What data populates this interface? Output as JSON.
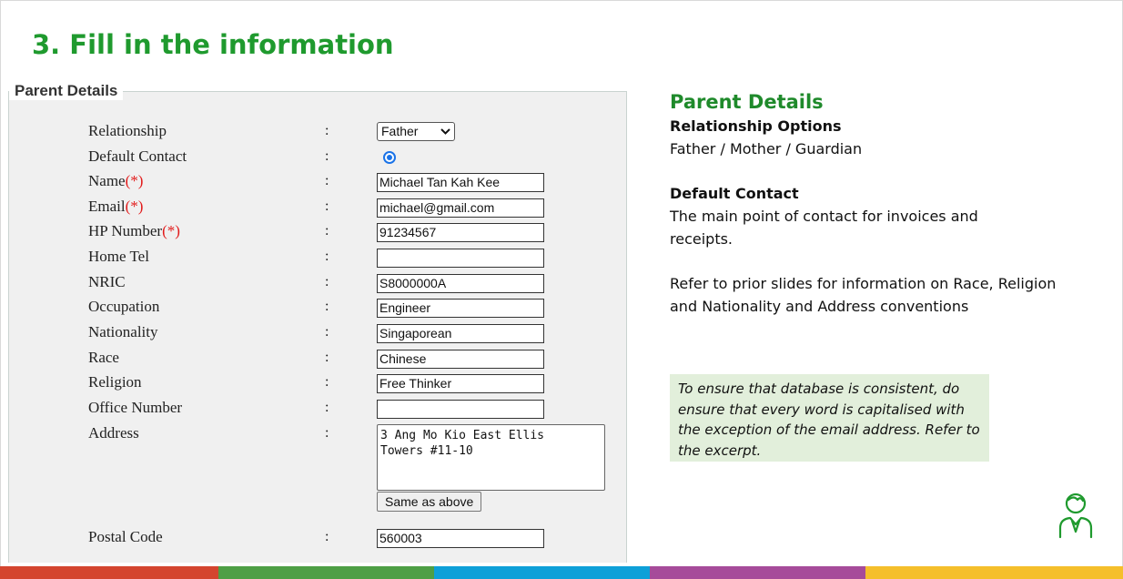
{
  "slide": {
    "title": "3. Fill in the information"
  },
  "form": {
    "legend": "Parent Details",
    "colon": ":",
    "required_marker": "(*)",
    "fields": {
      "relationship": {
        "label": "Relationship",
        "value": "Father"
      },
      "default_contact": {
        "label": "Default Contact",
        "checked": true
      },
      "name": {
        "label": "Name",
        "value": "Michael Tan Kah Kee"
      },
      "email": {
        "label": "Email",
        "value": "michael@gmail.com"
      },
      "hp": {
        "label": "HP Number",
        "value": "91234567"
      },
      "home_tel": {
        "label": "Home Tel",
        "value": ""
      },
      "nric": {
        "label": "NRIC",
        "value": "S8000000A"
      },
      "occupation": {
        "label": "Occupation",
        "value": "Engineer"
      },
      "nationality": {
        "label": "Nationality",
        "value": "Singaporean"
      },
      "race": {
        "label": "Race",
        "value": "Chinese"
      },
      "religion": {
        "label": "Religion",
        "value": "Free Thinker"
      },
      "office": {
        "label": "Office Number",
        "value": ""
      },
      "address": {
        "label": "Address",
        "value": "3 Ang Mo Kio East Ellis\nTowers #11-10"
      },
      "postal": {
        "label": "Postal Code",
        "value": "560003"
      }
    },
    "same_as_above_label": "Same as above"
  },
  "info": {
    "heading": "Parent Details",
    "relationship_title": "Relationship Options",
    "relationship_text": "Father / Mother / Guardian",
    "default_title": "Default Contact",
    "default_text": "The main point of contact for invoices and receipts.",
    "refer_text": "Refer to prior slides for information on Race, Religion and Nationality and Address conventions",
    "note": "To ensure that database is consistent, do ensure that every word is capitalised with the exception of the email address. Refer to the excerpt."
  },
  "colors": {
    "title_green": "#1f9a2e",
    "note_bg": "#e2efdb",
    "footer": [
      "#d4452f",
      "#4e9f45",
      "#0ea0d8",
      "#a64b9a",
      "#f5bf2b"
    ]
  },
  "icons": {
    "person": "person-icon"
  }
}
